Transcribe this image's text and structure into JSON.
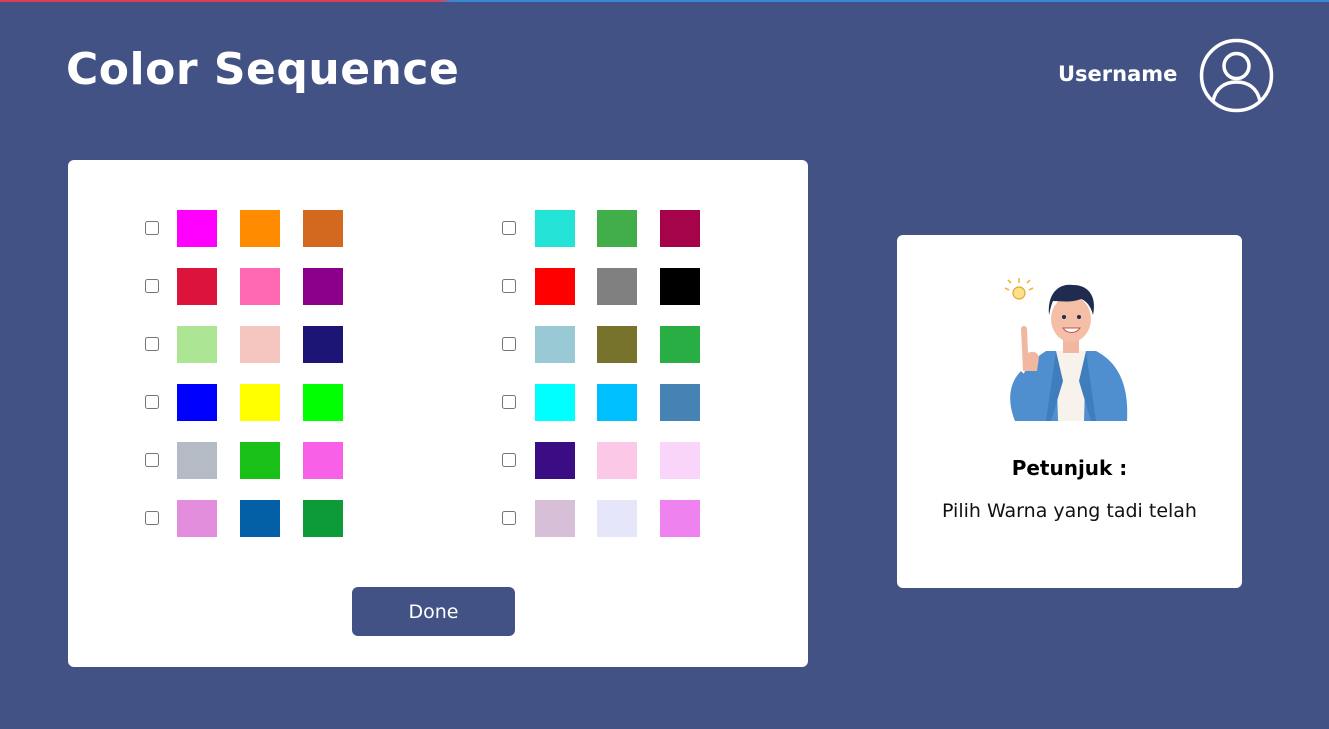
{
  "header": {
    "title": "Color Sequence",
    "username": "Username",
    "avatar_icon": "user-circle-icon"
  },
  "colors": {
    "background": "#435285",
    "panel": "#ffffff",
    "button": "#435285"
  },
  "grid": {
    "left_column": [
      [
        "#FF00FF",
        "#FF8C00",
        "#D2691E"
      ],
      [
        "#DC143C",
        "#FF69B4",
        "#8B008B"
      ],
      [
        "#ACE594",
        "#F5C5C0",
        "#1C1575"
      ],
      [
        "#0000FF",
        "#FFFF00",
        "#00FF00"
      ],
      [
        "#B4BBC4",
        "#18C018",
        "#F960E8"
      ],
      [
        "#E28EDD",
        "#0460A6",
        "#0D9A38"
      ]
    ],
    "right_column": [
      [
        "#23E3D7",
        "#41AE4A",
        "#A5044A"
      ],
      [
        "#FF0000",
        "#808080",
        "#000000"
      ],
      [
        "#98C9D5",
        "#78732C",
        "#28AE45"
      ],
      [
        "#00FFFF",
        "#00BFFF",
        "#4682B4"
      ],
      [
        "#3A0D84",
        "#FBC8E8",
        "#FAD5FA"
      ],
      [
        "#D8BFD8",
        "#E6E6FA",
        "#EE82EE"
      ]
    ]
  },
  "done_button": {
    "label": "Done"
  },
  "hint": {
    "title": "Petunjuk :",
    "text": "Pilih Warna yang tadi telah",
    "illustration_icon": "idea-person-illustration-icon"
  }
}
